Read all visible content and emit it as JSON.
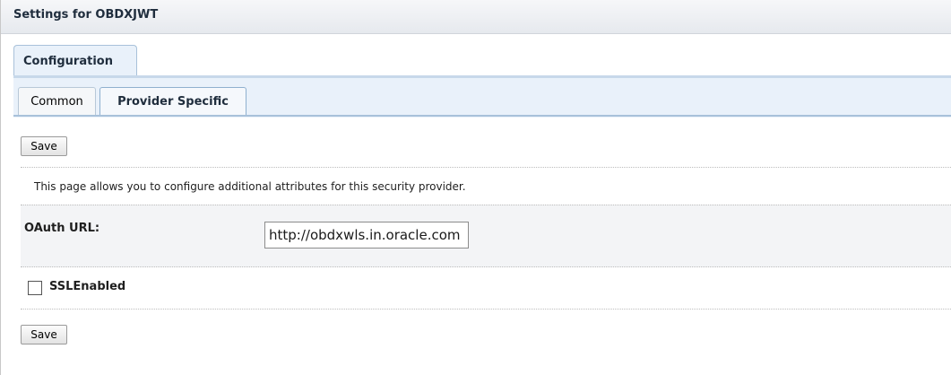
{
  "header": {
    "title": "Settings for OBDXJWT"
  },
  "tabs": {
    "main": [
      {
        "label": "Configuration",
        "selected": true
      }
    ],
    "sub": [
      {
        "label": "Common",
        "selected": false
      },
      {
        "label": "Provider Specific",
        "selected": true
      }
    ]
  },
  "toolbar": {
    "save_label": "Save"
  },
  "info": {
    "text": "This page allows you to configure additional attributes for this security provider."
  },
  "form": {
    "oauth_url": {
      "label": "OAuth URL:",
      "value": "http://obdxwls.in.oracle.com"
    },
    "ssl_enabled": {
      "label": "SSLEnabled",
      "checked": false
    }
  },
  "footer": {
    "save_label": "Save"
  },
  "colors": {
    "tab_background": "#e9f1fa",
    "tab_border": "#a8c1da",
    "header_gradient_top": "#f6f7f9",
    "header_gradient_bottom": "#e6e9ee"
  }
}
